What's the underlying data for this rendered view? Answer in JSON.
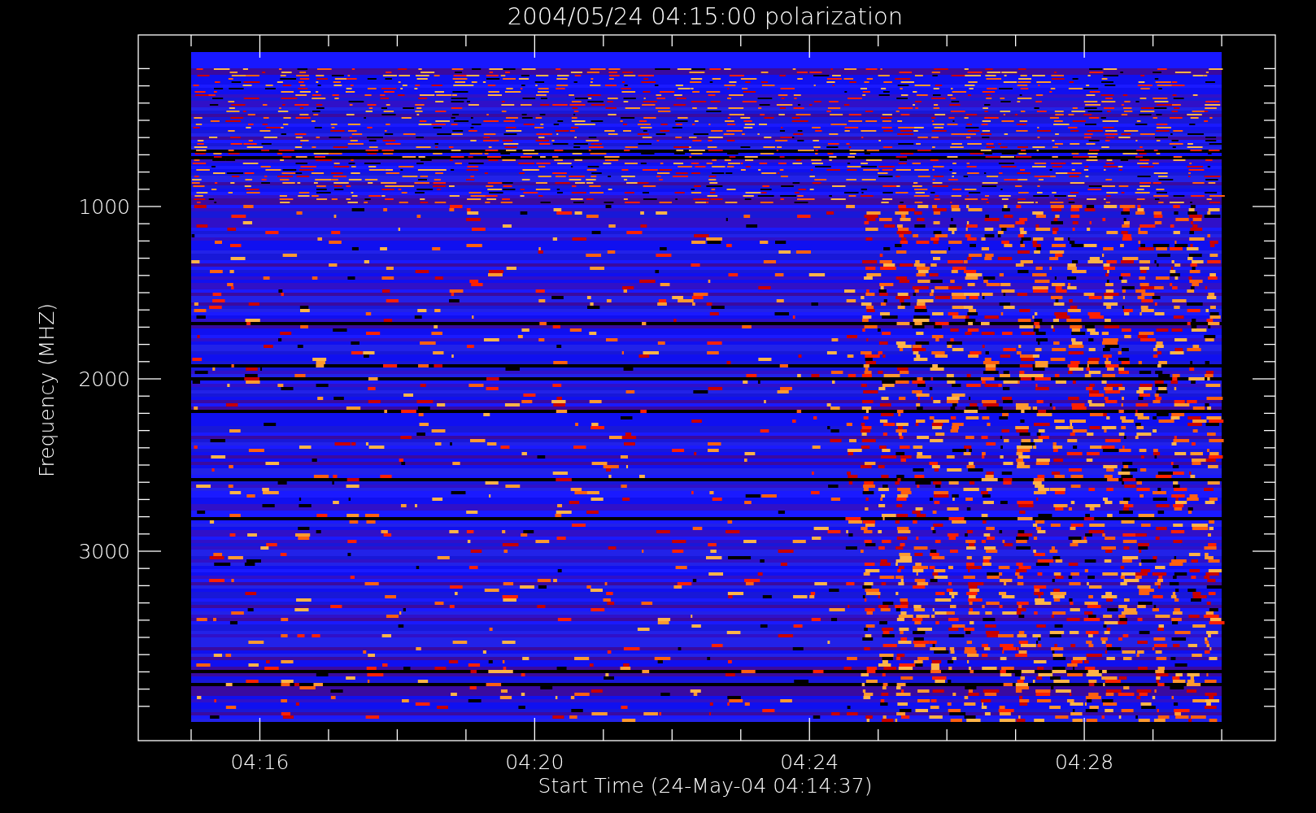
{
  "title": "2004/05/24 04:15:00 polarization",
  "y_axis": {
    "label": "Frequency (MHZ)",
    "tick_labels": [
      "1000",
      "2000",
      "3000"
    ]
  },
  "x_axis": {
    "label": "Start Time (24-May-04 04:14:37)",
    "tick_labels": [
      "04:16",
      "04:20",
      "04:24",
      "04:28"
    ]
  }
}
